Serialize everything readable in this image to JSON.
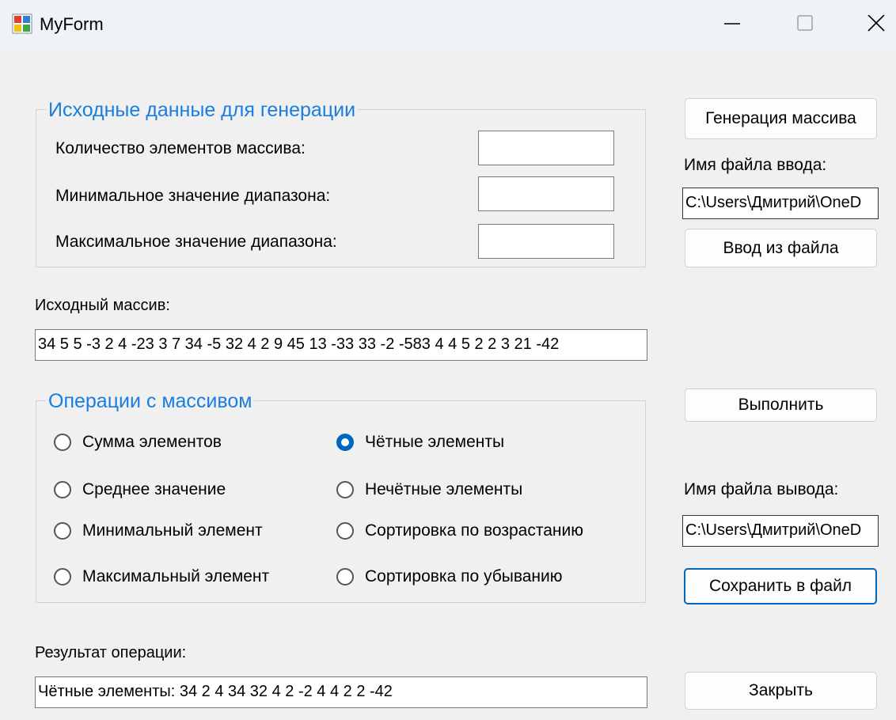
{
  "window": {
    "title": "MyForm",
    "controls": {
      "minimize": "minimize-icon",
      "maximize": "maximize-icon",
      "close": "close-icon"
    }
  },
  "gen_group": {
    "title": "Исходные данные для генерации",
    "count_label": "Количество элементов массива:",
    "count_value": "",
    "min_label": "Минимальное значение диапазона:",
    "min_value": "",
    "max_label": "Максимальное значение диапазона:",
    "max_value": ""
  },
  "right_panel": {
    "generate_button": "Генерация массива",
    "input_file_label": "Имя файла ввода:",
    "input_file_path": "C:\\Users\\Дмитрий\\OneD",
    "load_button": "Ввод из файла",
    "execute_button": "Выполнить",
    "output_file_label": "Имя файла вывода:",
    "output_file_path": "C:\\Users\\Дмитрий\\OneD",
    "save_button": "Сохранить в файл",
    "close_button": "Закрыть"
  },
  "source_array": {
    "label": "Исходный массив:",
    "value": "34 5 5 -3 2 4 -23 3 7 34 -5 32 4 2 9 45 13 -33 33 -2 -583 4 4 5 2 2 3 21 -42"
  },
  "operations": {
    "title": "Операции с массивом",
    "options": [
      {
        "label": "Сумма элементов",
        "checked": false
      },
      {
        "label": "Чётные элементы",
        "checked": true
      },
      {
        "label": "Среднее значение",
        "checked": false
      },
      {
        "label": "Нечётные элементы",
        "checked": false
      },
      {
        "label": "Минимальный элемент",
        "checked": false
      },
      {
        "label": "Сортировка по возрастанию",
        "checked": false
      },
      {
        "label": "Максимальный элемент",
        "checked": false
      },
      {
        "label": "Сортировка по убыванию",
        "checked": false
      }
    ]
  },
  "result": {
    "label": "Результат операции:",
    "value": "Чётные элементы: 34 2 4 34 32 4 2 -2 4 4 2 2 -42"
  },
  "colors": {
    "accent": "#0067c0",
    "group_title": "#1a7ee0",
    "background": "#f0f0f0"
  }
}
